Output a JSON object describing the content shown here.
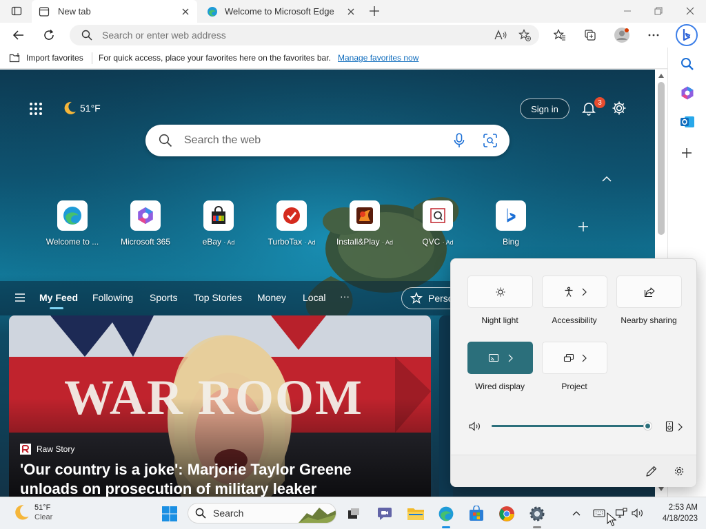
{
  "tabs": [
    {
      "title": "New tab",
      "active": true
    },
    {
      "title": "Welcome to Microsoft Edge",
      "active": false
    }
  ],
  "address_bar": {
    "placeholder": "Search or enter web address"
  },
  "favorites_bar": {
    "import_label": "Import favorites",
    "message": "For quick access, place your favorites here on the favorites bar.",
    "manage_link": "Manage favorites now"
  },
  "new_tab_page": {
    "weather": "51°F",
    "sign_in": "Sign in",
    "notification_count": "3",
    "search_placeholder": "Search the web",
    "quick_links": [
      {
        "label": "Welcome to ...",
        "ad": ""
      },
      {
        "label": "Microsoft 365",
        "ad": ""
      },
      {
        "label": "eBay",
        "ad": "· Ad"
      },
      {
        "label": "TurboTax",
        "ad": "· Ad"
      },
      {
        "label": "Install&Play",
        "ad": "· Ad"
      },
      {
        "label": "QVC",
        "ad": "· Ad"
      },
      {
        "label": "Bing",
        "ad": ""
      }
    ],
    "feed_tabs": [
      "My Feed",
      "Following",
      "Sports",
      "Top Stories",
      "Money",
      "Local"
    ],
    "more_label": "···",
    "personalize_label": "Perso",
    "article": {
      "source": "Raw Story",
      "headline_line1": "'Our country is a joke': Marjorie Taylor Greene",
      "headline_line2": "unloads on prosecution of military leaker",
      "image_text": "WAR ROOM"
    }
  },
  "quick_settings": {
    "row1": [
      {
        "label": "Night light",
        "on": false
      },
      {
        "label": "Accessibility",
        "on": false
      },
      {
        "label": "Nearby sharing",
        "on": false
      }
    ],
    "row2": [
      {
        "label": "Wired display",
        "on": true
      },
      {
        "label": "Project",
        "on": false
      }
    ],
    "volume_fraction": 1.0
  },
  "taskbar": {
    "weather_temp": "51°F",
    "weather_condition": "Clear",
    "search_label": "Search",
    "time": "2:53 AM",
    "date": "4/18/2023"
  },
  "colors": {
    "accent": "#2b6f7b",
    "link": "#0f6cbd",
    "badge": "#e74c2e"
  }
}
